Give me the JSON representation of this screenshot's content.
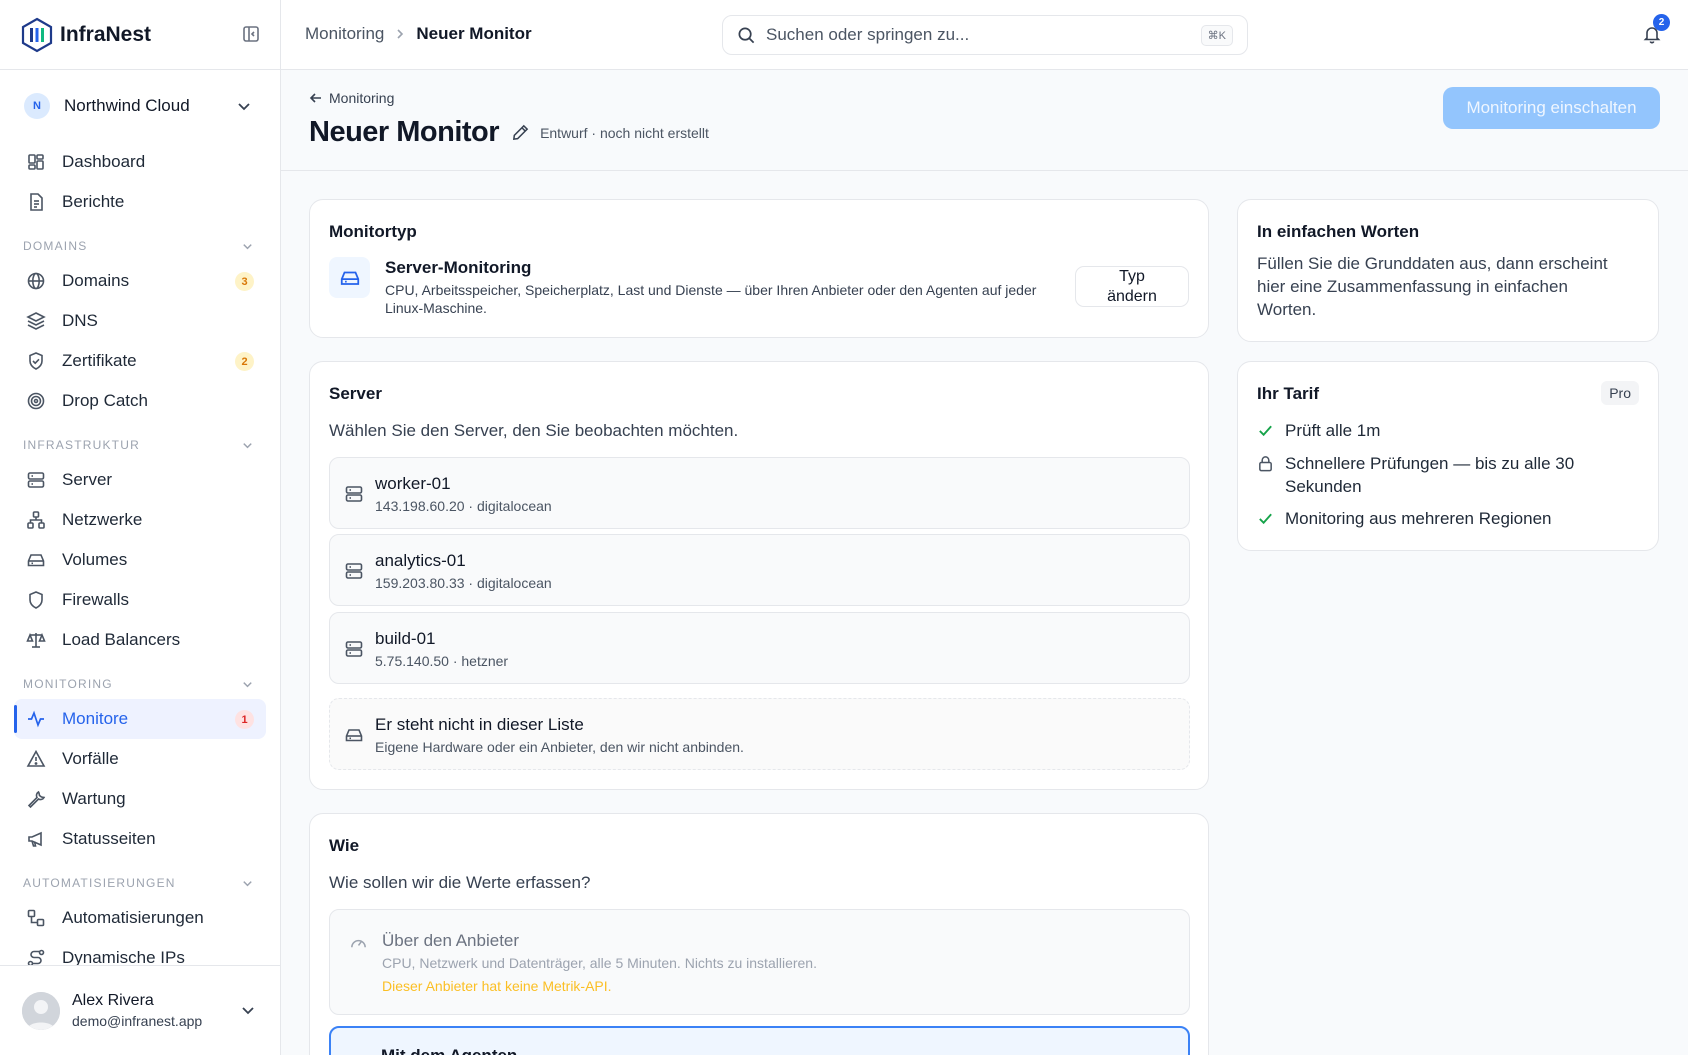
{
  "app": {
    "brand": "InfraNest",
    "org": {
      "initial": "N",
      "name": "Northwind Cloud"
    },
    "user": {
      "name": "Alex Rivera",
      "email": "demo@infranest.app"
    }
  },
  "colors": {
    "accent": "#2563eb",
    "accent_light": "#93c5fd",
    "warning": "#d97706",
    "danger": "#dc2626",
    "success": "#16a34a"
  },
  "nav": {
    "top": [
      {
        "label": "Dashboard",
        "icon": "dashboard-icon"
      },
      {
        "label": "Berichte",
        "icon": "report-icon"
      }
    ],
    "domains": {
      "title": "DOMAINS",
      "items": [
        {
          "label": "Domains",
          "icon": "globe-icon",
          "badge": "3"
        },
        {
          "label": "DNS",
          "icon": "layers-icon"
        },
        {
          "label": "Zertifikate",
          "icon": "shield-check-icon",
          "badge": "2"
        },
        {
          "label": "Drop Catch",
          "icon": "target-icon"
        }
      ]
    },
    "infra": {
      "title": "INFRASTRUKTUR",
      "items": [
        {
          "label": "Server",
          "icon": "server-icon"
        },
        {
          "label": "Netzwerke",
          "icon": "network-icon"
        },
        {
          "label": "Volumes",
          "icon": "drive-icon"
        },
        {
          "label": "Firewalls",
          "icon": "shield-icon"
        },
        {
          "label": "Load Balancers",
          "icon": "scale-icon"
        }
      ]
    },
    "monitoring": {
      "title": "MONITORING",
      "items": [
        {
          "label": "Monitore",
          "icon": "activity-icon",
          "badge": "1",
          "active": true
        },
        {
          "label": "Vorfälle",
          "icon": "alert-icon"
        },
        {
          "label": "Wartung",
          "icon": "wrench-icon"
        },
        {
          "label": "Statusseiten",
          "icon": "megaphone-icon"
        }
      ]
    },
    "automation": {
      "title": "AUTOMATISIERUNGEN",
      "items": [
        {
          "label": "Automatisierungen",
          "icon": "workflow-icon"
        },
        {
          "label": "Dynamische IPs",
          "icon": "route-icon"
        }
      ]
    }
  },
  "topbar": {
    "breadcrumb": [
      "Monitoring",
      "Neuer Monitor"
    ],
    "search_placeholder": "Suchen oder springen zu...",
    "search_shortcut": "⌘K",
    "notifications": "2"
  },
  "header": {
    "back_label": "Monitoring",
    "title": "Neuer Monitor",
    "status": "Entwurf · noch nicht erstellt",
    "primary_action": "Monitoring einschalten"
  },
  "monitor_type": {
    "title": "Monitortyp",
    "name": "Server-Monitoring",
    "description": "CPU, Arbeitsspeicher, Speicherplatz, Last und Dienste — über Ihren Anbieter oder den Agenten auf jeder Linux-Maschine.",
    "change_label_1": "Typ",
    "change_label_2": "ändern"
  },
  "server": {
    "title": "Server",
    "subtitle": "Wählen Sie den Server, den Sie beobachten möchten.",
    "items": [
      {
        "name": "worker-01",
        "meta": "143.198.60.20 · digitalocean"
      },
      {
        "name": "analytics-01",
        "meta": "159.203.80.33 · digitalocean"
      },
      {
        "name": "build-01",
        "meta": "5.75.140.50 · hetzner"
      }
    ],
    "other": {
      "name": "Er steht nicht in dieser Liste",
      "meta": "Eigene Hardware oder ein Anbieter, den wir nicht anbinden."
    }
  },
  "how": {
    "title": "Wie",
    "subtitle": "Wie sollen wir die Werte erfassen?",
    "provider": {
      "name": "Über den Anbieter",
      "description": "CPU, Netzwerk und Datenträger, alle 5 Minuten. Nichts zu installieren.",
      "warning": "Dieser Anbieter hat keine Metrik-API."
    },
    "agent": {
      "name": "Mit dem Agenten"
    }
  },
  "summary": {
    "title": "In einfachen Worten",
    "text": "Füllen Sie die Grunddaten aus, dann erscheint hier eine Zusammenfassung in einfachen Worten."
  },
  "plan": {
    "title": "Ihr Tarif",
    "badge": "Pro",
    "features": [
      {
        "text": "Prüft alle 1m",
        "icon": "check-icon"
      },
      {
        "text": "Schnellere Prüfungen — bis zu alle 30 Sekunden",
        "icon": "lock-icon"
      },
      {
        "text": "Monitoring aus mehreren Regionen",
        "icon": "check-icon"
      }
    ]
  }
}
